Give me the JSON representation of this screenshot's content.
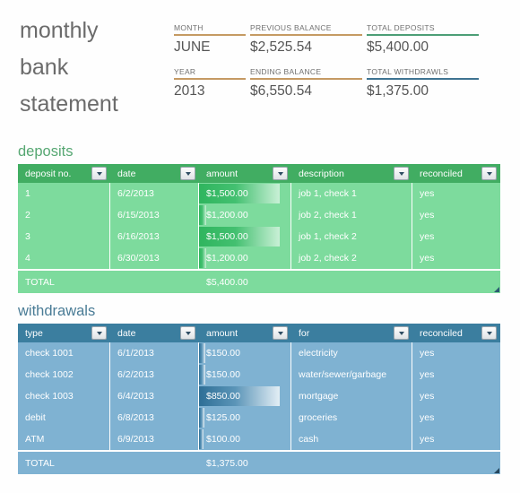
{
  "title": {
    "line1": "monthly",
    "line2": "bank",
    "line3": "statement"
  },
  "summary": {
    "row1": [
      {
        "label": "MONTH",
        "value": "JUNE",
        "rule_color": "#c59a63"
      },
      {
        "label": "PREVIOUS BALANCE",
        "value": "$2,525.54",
        "rule_color": "#c59a63"
      },
      {
        "label": "TOTAL DEPOSITS",
        "value": "$5,400.00",
        "rule_color": "#4c9e76"
      }
    ],
    "row2": [
      {
        "label": "YEAR",
        "value": "2013",
        "rule_color": "#c59a63"
      },
      {
        "label": "ENDING BALANCE",
        "value": "$6,550.54",
        "rule_color": "#c59a63"
      },
      {
        "label": "TOTAL WITHDRAWLS",
        "value": "$1,375.00",
        "rule_color": "#3f7391"
      }
    ]
  },
  "deposits": {
    "heading": "deposits",
    "accent": "#41ad62",
    "row_bg": "#7ddb9d",
    "columns": [
      "deposit no.",
      "date",
      "amount",
      "description",
      "reconciled"
    ],
    "filter_icon": "chevron-down-icon",
    "rows": [
      {
        "no": "1",
        "date": "6/2/2013",
        "amount": "$1,500.00",
        "bar_pct": 88,
        "description": "job 1, check 1",
        "reconciled": "yes"
      },
      {
        "no": "2",
        "date": "6/15/2013",
        "amount": "$1,200.00",
        "bar_pct": 8,
        "description": "job 2, check 1",
        "reconciled": "yes"
      },
      {
        "no": "3",
        "date": "6/16/2013",
        "amount": "$1,500.00",
        "bar_pct": 88,
        "description": "job 1, check 2",
        "reconciled": "yes"
      },
      {
        "no": "4",
        "date": "6/30/2013",
        "amount": "$1,200.00",
        "bar_pct": 8,
        "description": "job 2, check 2",
        "reconciled": "yes"
      }
    ],
    "total_label": "TOTAL",
    "total_value": "$5,400.00"
  },
  "withdrawals": {
    "heading": "withdrawals",
    "accent": "#3b7e9f",
    "row_bg": "#7fb2d2",
    "columns": [
      "type",
      "date",
      "amount",
      "for",
      "reconciled"
    ],
    "filter_icon": "chevron-down-icon",
    "rows": [
      {
        "type": "check 1001",
        "date": "6/1/2013",
        "amount": "$150.00",
        "bar_pct": 7,
        "for": "electricity",
        "reconciled": "yes"
      },
      {
        "type": "check 1002",
        "date": "6/2/2013",
        "amount": "$150.00",
        "bar_pct": 7,
        "for": "water/sewer/garbage",
        "reconciled": "yes"
      },
      {
        "type": "check 1003",
        "date": "6/4/2013",
        "amount": "$850.00",
        "bar_pct": 88,
        "for": "mortgage",
        "reconciled": "yes"
      },
      {
        "type": "debit",
        "date": "6/8/2013",
        "amount": "$125.00",
        "bar_pct": 6,
        "for": "groceries",
        "reconciled": "yes"
      },
      {
        "type": "ATM",
        "date": "6/9/2013",
        "amount": "$100.00",
        "bar_pct": 5,
        "for": "cash",
        "reconciled": "yes"
      }
    ],
    "total_label": "TOTAL",
    "total_value": "$1,375.00"
  }
}
